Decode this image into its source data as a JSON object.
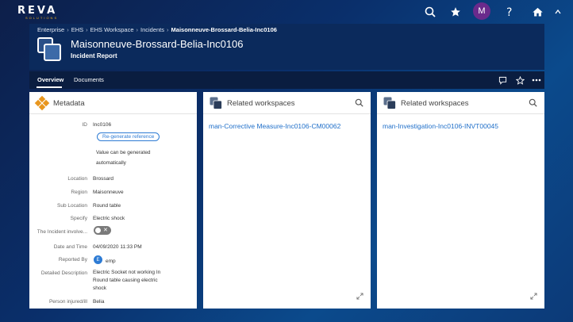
{
  "app": {
    "logo_text": "REVA",
    "logo_subtext": "SOLUTIONS",
    "user_initial": "M"
  },
  "breadcrumb": [
    "Enterprise",
    "EHS",
    "EHS Workspace",
    "Incidents",
    "Maisonneuve-Brossard-Belia-Inc0106"
  ],
  "header": {
    "title": "Maisonneuve-Brossard-Belia-Inc0106",
    "subtitle": "Incident Report"
  },
  "tabs": [
    {
      "label": "Overview",
      "active": true
    },
    {
      "label": "Documents",
      "active": false
    }
  ],
  "metadata": {
    "title": "Metadata",
    "id_label": "ID",
    "id_value": "Inc0106",
    "regen_button": "Re-generate reference",
    "regen_note": "Value can be generated automatically",
    "fields": [
      {
        "label": "Location",
        "value": "Brossard"
      },
      {
        "label": "Region",
        "value": "Maisonneuve"
      },
      {
        "label": "Sub Location",
        "value": "Round table"
      },
      {
        "label": "Specify",
        "value": "Electric shock"
      }
    ],
    "involve_label": "The Incident involve...",
    "datetime_label": "Date and Time",
    "datetime_value": "04/09/2020 11:33 PM",
    "reported_by_label": "Reported By",
    "reported_by_initial": "E",
    "reported_by_value": "emp",
    "description_label": "Detailed Description",
    "description_value": "Electric Socket not working In Round table causing electric shock",
    "person_label": "Person injured/ill",
    "person_value": "Belia"
  },
  "related1": {
    "title": "Related workspaces",
    "link": "man-Corrective Measure-Inc0106-CM00062"
  },
  "related2": {
    "title": "Related workspaces",
    "link": "man-Investigation-Inc0106-INVT00045"
  },
  "colors": {
    "accent": "#1f6fc9",
    "header_bg": "#0b2a5c",
    "metadata_icon": "#e8961e"
  }
}
